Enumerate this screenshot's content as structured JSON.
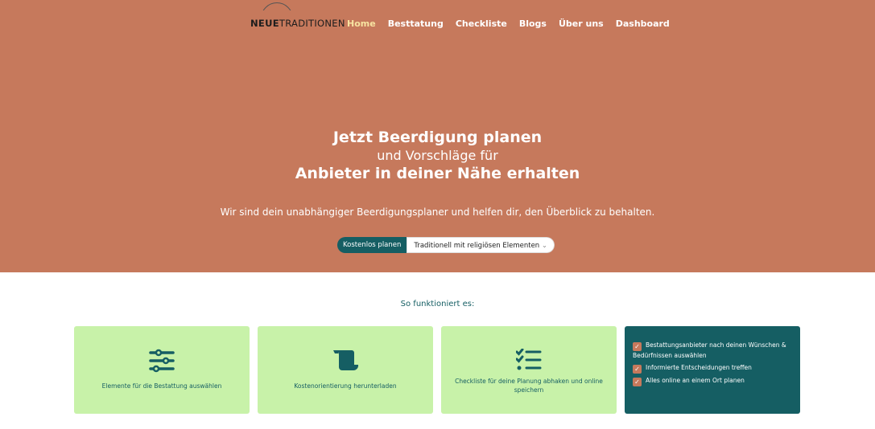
{
  "header": {
    "logo_bold": "NEUE",
    "logo_rest": "TRADITIONEN",
    "nav": [
      "Home",
      "Besttatung",
      "Checkliste",
      "Blogs",
      "Über uns",
      "Dashboard"
    ]
  },
  "hero": {
    "line1": "Jetzt Beerdigung planen",
    "line2": "und Vorschläge für",
    "line3": "Anbieter in deiner Nähe erhalten",
    "subtitle": "Wir sind dein unabhängiger Beerdigungsplaner und helfen dir, den Überblick zu behalten.",
    "cta_label": "Kostenlos planen",
    "select_value": "Traditionell mit religiösen Elementen"
  },
  "how": {
    "title": "So funktioniert es:",
    "cards": [
      "Elemente für die Bestattung auswählen",
      "Kostenorientierung herunterladen",
      "Checkliste für deine Planung abhaken und online speichern"
    ],
    "benefits": [
      "Bestattungsanbieter nach deinen Wünschen & Bedürfnissen auswählen",
      "Informierte Entscheidungen treffen",
      "Alles online an einem  Ort planen"
    ]
  },
  "colors": {
    "hero": "#c6795c",
    "teal": "#155e63",
    "card": "#c8f2a9"
  }
}
